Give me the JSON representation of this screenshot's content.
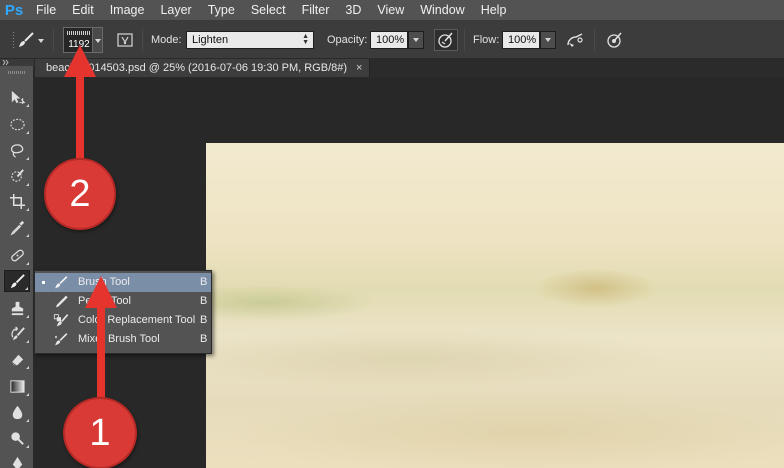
{
  "menubar": {
    "logo": "Ps",
    "items": [
      "File",
      "Edit",
      "Image",
      "Layer",
      "Type",
      "Select",
      "Filter",
      "3D",
      "View",
      "Window",
      "Help"
    ]
  },
  "options": {
    "brush_size": "1192",
    "mode_label": "Mode:",
    "mode_value": "Lighten",
    "opacity_label": "Opacity:",
    "opacity_value": "100%",
    "flow_label": "Flow:",
    "flow_value": "100%"
  },
  "document": {
    "tab_title": "beach_1014503.psd @ 25% (2016-07-06 19:30 PM, RGB/8#)",
    "close_glyph": "×"
  },
  "flyout": {
    "items": [
      {
        "label": "Brush Tool",
        "key": "B",
        "selected": true
      },
      {
        "label": "Pencil Tool",
        "key": "B",
        "selected": false
      },
      {
        "label": "Color Replacement Tool",
        "key": "B",
        "selected": false
      },
      {
        "label": "Mixer Brush Tool",
        "key": "B",
        "selected": false
      }
    ]
  },
  "annotations": {
    "callout_1": "1",
    "callout_2": "2",
    "color": "#d93a35"
  },
  "colors": {
    "ps_blue": "#31a8ff",
    "menu_bg": "#535353",
    "options_bg": "#3c3c3c",
    "selection": "#7a8ea8"
  }
}
